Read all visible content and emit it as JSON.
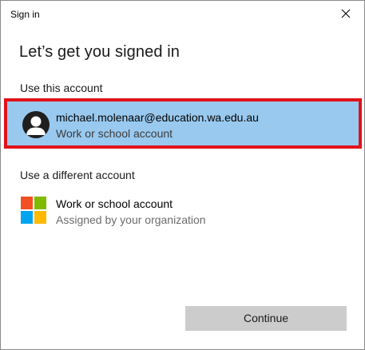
{
  "window": {
    "title": "Sign in"
  },
  "heading": "Let’s get you signed in",
  "sections": {
    "current": {
      "label": "Use this account",
      "account": {
        "email": "michael.molenaar@education.wa.edu.au",
        "type": "Work or school account",
        "icon": "person-avatar-icon"
      }
    },
    "different": {
      "label": "Use a different account",
      "option": {
        "title": "Work or school account",
        "subtitle": "Assigned by your organization",
        "icon": "microsoft-logo-icon"
      }
    }
  },
  "actions": {
    "continue_label": "Continue"
  },
  "colors": {
    "selected_tile": "#99c9ef",
    "highlight_border": "#e0131a",
    "button_bg": "#cccccc",
    "ms_red": "#f25022",
    "ms_green": "#7fba00",
    "ms_blue": "#00a4ef",
    "ms_yellow": "#ffb900"
  }
}
